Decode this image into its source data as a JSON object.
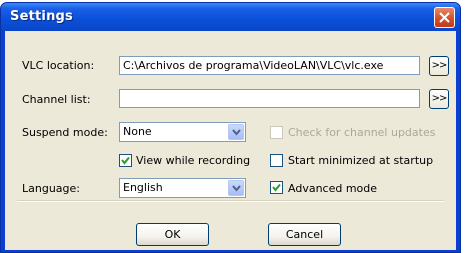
{
  "window": {
    "title": "Settings"
  },
  "vlc_location": {
    "label": "VLC location:",
    "value": "C:\\Archivos de programa\\VideoLAN\\VLC\\vlc.exe",
    "browse_label": ">>"
  },
  "channel_list": {
    "label": "Channel list:",
    "value": "",
    "browse_label": ">>"
  },
  "suspend_mode": {
    "label": "Suspend mode:",
    "value": "None"
  },
  "language": {
    "label": "Language:",
    "value": "English"
  },
  "checkboxes": {
    "check_updates": {
      "label": "Check for channel updates",
      "checked": false,
      "enabled": false
    },
    "view_while_recording": {
      "label": "View while recording",
      "checked": true
    },
    "start_minimized": {
      "label": "Start minimized at startup",
      "checked": false
    },
    "advanced_mode": {
      "label": "Advanced mode",
      "checked": true
    }
  },
  "buttons": {
    "ok": "OK",
    "cancel": "Cancel"
  }
}
